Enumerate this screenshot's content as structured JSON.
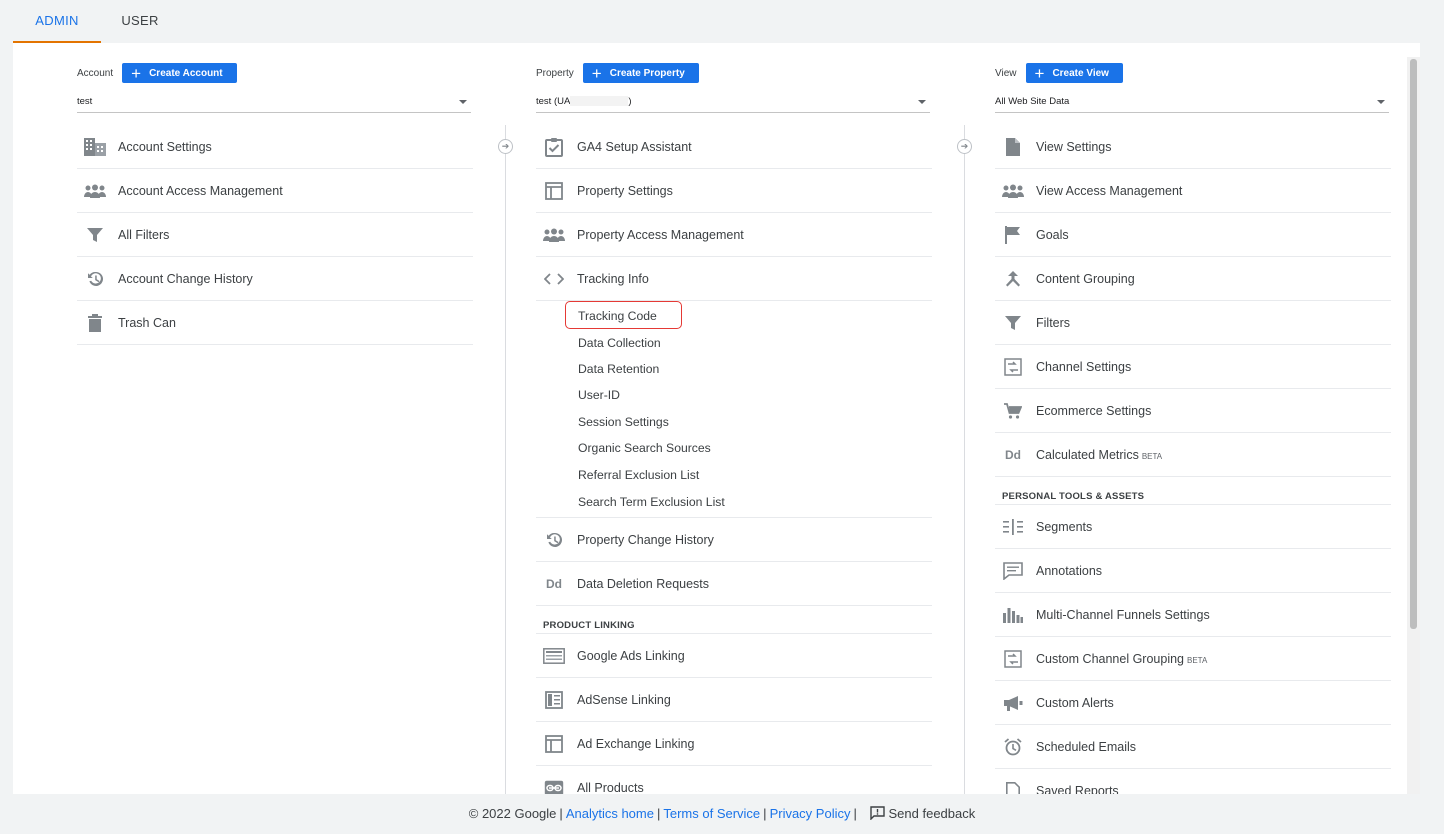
{
  "tabs": {
    "admin": "ADMIN",
    "user": "USER"
  },
  "account": {
    "label": "Account",
    "create": "Create Account",
    "selected": "test",
    "items": [
      {
        "label": "Account Settings",
        "icon": "building-icon"
      },
      {
        "label": "Account Access Management",
        "icon": "people-icon"
      },
      {
        "label": "All Filters",
        "icon": "filter-icon"
      },
      {
        "label": "Account Change History",
        "icon": "history-icon"
      },
      {
        "label": "Trash Can",
        "icon": "trash-icon"
      }
    ]
  },
  "property": {
    "label": "Property",
    "create": "Create Property",
    "selected_prefix": "test (UA",
    "selected_suffix": ")",
    "items": [
      {
        "label": "GA4 Setup Assistant",
        "icon": "checklist-icon"
      },
      {
        "label": "Property Settings",
        "icon": "layout-icon"
      },
      {
        "label": "Property Access Management",
        "icon": "people-icon"
      },
      {
        "label": "Tracking Info",
        "icon": "code-icon"
      }
    ],
    "tracking_subitems": [
      "Tracking Code",
      "Data Collection",
      "Data Retention",
      "User-ID",
      "Session Settings",
      "Organic Search Sources",
      "Referral Exclusion List",
      "Search Term Exclusion List"
    ],
    "items_after": [
      {
        "label": "Property Change History",
        "icon": "history-icon"
      },
      {
        "label": "Data Deletion Requests",
        "icon": "dd-icon"
      }
    ],
    "linking_head": "PRODUCT LINKING",
    "linking": [
      {
        "label": "Google Ads Linking",
        "icon": "ads-icon"
      },
      {
        "label": "AdSense Linking",
        "icon": "adsense-icon"
      },
      {
        "label": "Ad Exchange Linking",
        "icon": "layout-icon"
      },
      {
        "label": "All Products",
        "icon": "link-icon"
      }
    ]
  },
  "view": {
    "label": "View",
    "create": "Create View",
    "selected": "All Web Site Data",
    "items": [
      {
        "label": "View Settings",
        "icon": "document-icon"
      },
      {
        "label": "View Access Management",
        "icon": "people-icon"
      },
      {
        "label": "Goals",
        "icon": "flag-icon"
      },
      {
        "label": "Content Grouping",
        "icon": "merge-icon"
      },
      {
        "label": "Filters",
        "icon": "filter-icon"
      },
      {
        "label": "Channel Settings",
        "icon": "channel-icon"
      },
      {
        "label": "Ecommerce Settings",
        "icon": "cart-icon"
      },
      {
        "label": "Calculated Metrics",
        "icon": "dd-icon",
        "badge": "BETA"
      }
    ],
    "tools_head": "PERSONAL TOOLS & ASSETS",
    "tools": [
      {
        "label": "Segments",
        "icon": "segments-icon"
      },
      {
        "label": "Annotations",
        "icon": "comment-icon"
      },
      {
        "label": "Multi-Channel Funnels Settings",
        "icon": "bars-icon"
      },
      {
        "label": "Custom Channel Grouping",
        "icon": "channel-icon",
        "badge": "BETA"
      },
      {
        "label": "Custom Alerts",
        "icon": "megaphone-icon"
      },
      {
        "label": "Scheduled Emails",
        "icon": "alarm-icon"
      },
      {
        "label": "Saved Reports",
        "icon": "document-icon"
      }
    ]
  },
  "footer": {
    "copyright": "© 2022 Google",
    "analytics_home": "Analytics home",
    "terms": "Terms of Service",
    "privacy": "Privacy Policy",
    "feedback": "Send feedback"
  }
}
